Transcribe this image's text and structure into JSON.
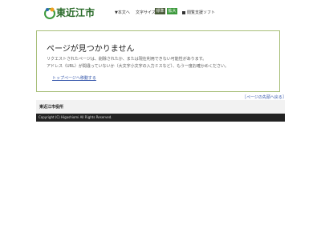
{
  "header": {
    "logo_text": "東近江市",
    "skip_link": "▼本文へ",
    "font_size_label": "文字サイズ",
    "font_standard": "標準",
    "font_large": "拡大",
    "reader_label": "閲覧支援ソフト"
  },
  "main": {
    "title": "ページが見つかりません",
    "message_1": "リクエストされたページは、削除されたか、または現在利用できない可能性があります。",
    "message_2": "アドレス（URL）が間違っていないか（大文字小文字の入力ミスなど）、もう一度お確かめください。",
    "top_link": "トップページへ移動する"
  },
  "page_top_link": "［ページの先頭へ戻る］",
  "footer": {
    "org_name": "東近江市役所",
    "copyright": "Copyright (C) Higashiomi All Rights Reserved."
  },
  "colors": {
    "box_border": "#a8bf7a",
    "link": "#3355aa",
    "footer_dark": "#222222"
  }
}
